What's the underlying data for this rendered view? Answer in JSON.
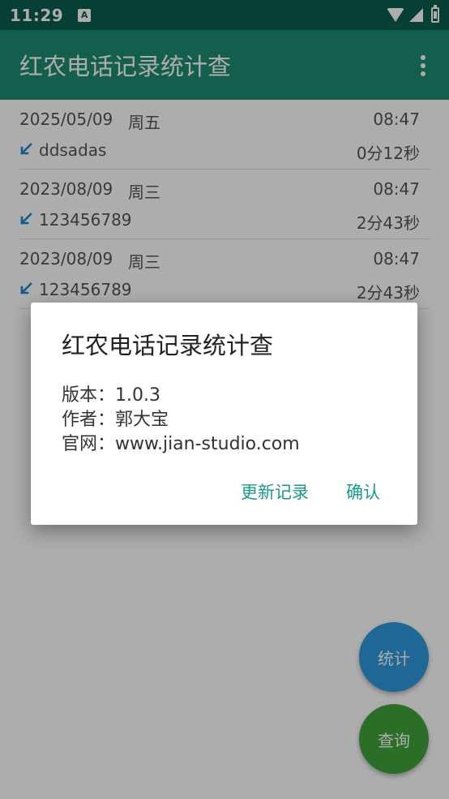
{
  "status_bar": {
    "time": "11:29",
    "app_icon_letter": "A"
  },
  "app_bar": {
    "title": "红农电话记录统计查"
  },
  "calls": [
    {
      "date": "2025/05/09",
      "weekday": "周五",
      "time": "08:47",
      "number": "ddsadas",
      "duration": "0分12秒"
    },
    {
      "date": "2023/08/09",
      "weekday": "周三",
      "time": "08:47",
      "number": "123456789",
      "duration": "2分43秒"
    },
    {
      "date": "2023/08/09",
      "weekday": "周三",
      "time": "08:47",
      "number": "123456789",
      "duration": "2分43秒"
    }
  ],
  "fab": {
    "stats_label": "统计",
    "query_label": "查询"
  },
  "dialog": {
    "title": "红农电话记录统计查",
    "version_line": "版本：1.0.3",
    "author_line": "作者：郭大宝",
    "website_line": "官网：www.jian-studio.com",
    "update_log_label": "更新记录",
    "confirm_label": "确认"
  },
  "colors": {
    "status_bar": "#0d5d4f",
    "app_bar": "#1e8b73",
    "incoming_arrow": "#1f87c9",
    "stats_fab": "#2f99dc",
    "query_fab": "#3fa33a",
    "dialog_button": "#1b9b86"
  },
  "icons": [
    "a-notification-icon",
    "wifi-icon",
    "signal-icon",
    "battery-icon",
    "overflow-menu-icon",
    "incoming-call-icon"
  ]
}
